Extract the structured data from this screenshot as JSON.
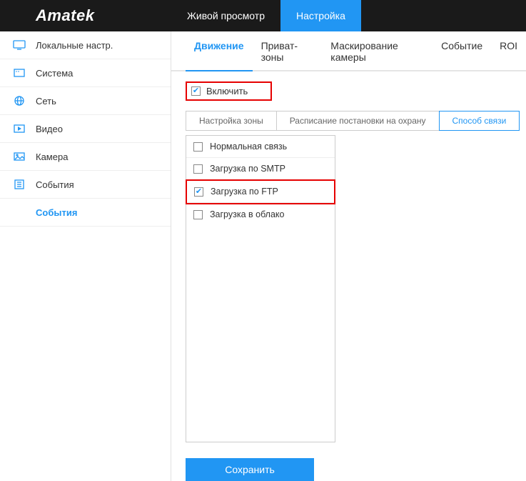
{
  "brand": "Amatek",
  "topTabs": {
    "live": "Живой просмотр",
    "settings": "Настройка"
  },
  "sidebar": {
    "items": [
      {
        "label": "Локальные настр."
      },
      {
        "label": "Система"
      },
      {
        "label": "Сеть"
      },
      {
        "label": "Видео"
      },
      {
        "label": "Камера"
      },
      {
        "label": "События"
      }
    ],
    "subActive": "События"
  },
  "subtabs": {
    "motion": "Движение",
    "privacy": "Приват-зоны",
    "masking": "Маскирование камеры",
    "event": "Событие",
    "roi": "ROI"
  },
  "enable": {
    "label": "Включить"
  },
  "crumbs": {
    "zone": "Настройка зоны",
    "schedule": "Расписание постановки на охрану",
    "link": "Способ связи"
  },
  "options": {
    "normal": "Нормальная связь",
    "smtp": "Загрузка по SMTP",
    "ftp": "Загрузка по FTP",
    "cloud": "Загрузка в облако"
  },
  "save": "Сохранить"
}
